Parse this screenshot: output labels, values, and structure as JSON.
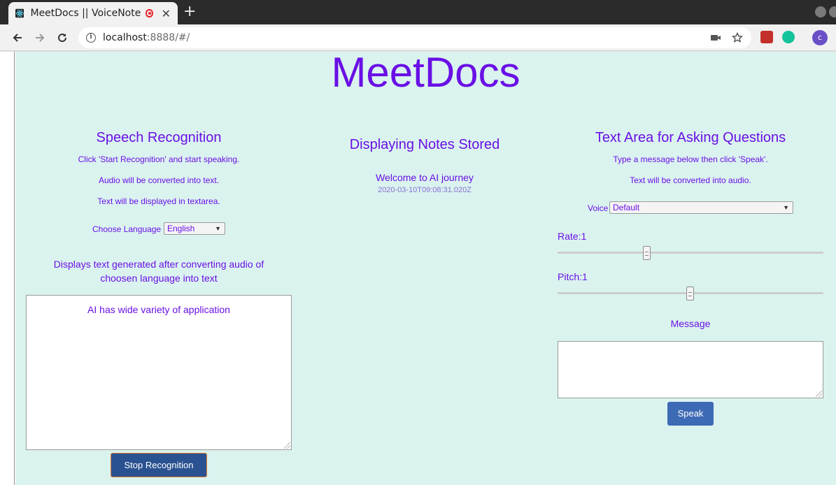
{
  "browser": {
    "tab_title": "MeetDocs || VoiceNote",
    "tab_close": "✕",
    "new_tab": "+",
    "url_host": "localhost",
    "url_rest": ":8888/#/",
    "avatar_letter": "c"
  },
  "page": {
    "title": "MeetDocs"
  },
  "speech": {
    "heading": "Speech Recognition",
    "line1": "Click 'Start Recognition' and start speaking.",
    "line2": "Audio will be converted into text.",
    "line3": "Text will be displayed in textarea.",
    "language_label": "Choose Language",
    "language_value": "English",
    "output_caption": "Displays text generated after converting audio of choosen language into text",
    "transcript": "AI has wide variety of application",
    "stop_button": "Stop Recognition"
  },
  "notes": {
    "heading": "Displaying Notes Stored",
    "items": [
      {
        "text": "Welcome to AI journey",
        "timestamp": "2020-03-10T09:08:31.020Z"
      }
    ]
  },
  "tts": {
    "heading": "Text Area for Asking Questions",
    "line1": "Type a message below then click 'Speak'.",
    "line2": "Text will be converted into audio.",
    "voice_label": "Voice",
    "voice_value": "Default",
    "rate_label": "Rate:1",
    "rate_value": 1,
    "pitch_label": "Pitch:1",
    "pitch_value": 1,
    "message_label": "Message",
    "message_value": "",
    "speak_button": "Speak"
  },
  "colors": {
    "accent": "#6a0fe5",
    "page_bg": "#daf3ef",
    "button_dark": "#2a5291",
    "button": "#3d6ab4"
  },
  "icons": [
    "react-favicon",
    "record-icon",
    "back-arrow-icon",
    "forward-arrow-icon",
    "reload-icon",
    "info-icon",
    "camera-icon",
    "star-icon",
    "extension-icon",
    "grammarly-icon",
    "profile-avatar"
  ]
}
